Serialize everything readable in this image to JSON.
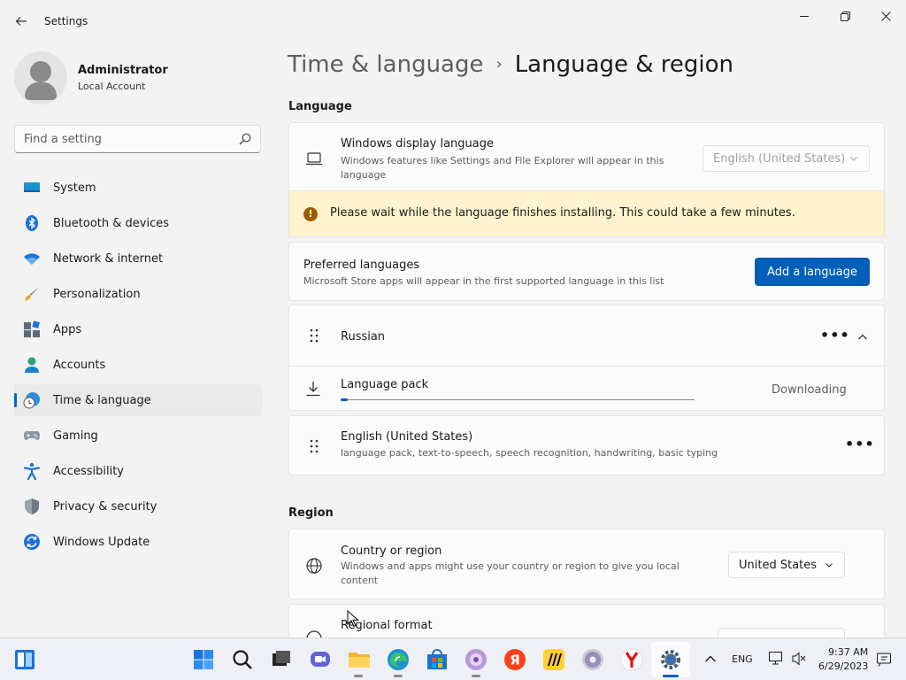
{
  "window": {
    "title": "Settings",
    "controls": {
      "minimize": "minimize-icon",
      "maximize": "maximize-icon",
      "close": "close-icon"
    }
  },
  "profile": {
    "name": "Administrator",
    "account_type": "Local Account"
  },
  "search": {
    "placeholder": "Find a setting"
  },
  "sidebar": {
    "items": [
      {
        "label": "System",
        "icon": "system-icon",
        "active": false
      },
      {
        "label": "Bluetooth & devices",
        "icon": "bluetooth-icon",
        "active": false
      },
      {
        "label": "Network & internet",
        "icon": "wifi-icon",
        "active": false
      },
      {
        "label": "Personalization",
        "icon": "brush-icon",
        "active": false
      },
      {
        "label": "Apps",
        "icon": "apps-icon",
        "active": false
      },
      {
        "label": "Accounts",
        "icon": "accounts-icon",
        "active": false
      },
      {
        "label": "Time & language",
        "icon": "time-language-icon",
        "active": true
      },
      {
        "label": "Gaming",
        "icon": "gamepad-icon",
        "active": false
      },
      {
        "label": "Accessibility",
        "icon": "accessibility-icon",
        "active": false
      },
      {
        "label": "Privacy & security",
        "icon": "shield-icon",
        "active": false
      },
      {
        "label": "Windows Update",
        "icon": "update-icon",
        "active": false
      }
    ]
  },
  "breadcrumb": {
    "parent": "Time & language",
    "separator": "›",
    "current": "Language & region"
  },
  "language_section": {
    "title": "Language",
    "display_language": {
      "title": "Windows display language",
      "description": "Windows features like Settings and File Explorer will appear in this language",
      "selected": "English (United States)",
      "disabled": true
    },
    "warning": "Please wait while the language finishes installing. This could take a few minutes.",
    "preferred": {
      "title": "Preferred languages",
      "description": "Microsoft Store apps will appear in the first supported language in this list",
      "button": "Add a language"
    },
    "languages": [
      {
        "name": "Russian",
        "expanded": true,
        "more": "•••",
        "pack": {
          "label": "Language pack",
          "status": "Downloading",
          "progress": 0.02
        }
      },
      {
        "name": "English (United States)",
        "features": "language pack, text-to-speech, speech recognition, handwriting, basic typing",
        "more": "•••"
      }
    ]
  },
  "region_section": {
    "title": "Region",
    "country": {
      "title": "Country or region",
      "description": "Windows and apps might use your country or region to give you local content",
      "selected": "United States"
    },
    "format": {
      "title": "Regional format"
    }
  },
  "taskbar": {
    "apps": [
      "start-icon",
      "search-icon",
      "task-view-icon",
      "chat-icon",
      "file-explorer-icon",
      "edge-icon",
      "store-icon",
      "media-player-icon",
      "yandex-icon",
      "miro-icon",
      "dvd-icon",
      "yandex-browser-icon",
      "settings-icon"
    ],
    "tray": {
      "language": "ENG",
      "time": "9:37 AM",
      "date": "6/29/2023"
    }
  },
  "colors": {
    "accent": "#005fb8",
    "warning_bg": "#fff4ce",
    "warning_icon": "#9d5d00"
  }
}
